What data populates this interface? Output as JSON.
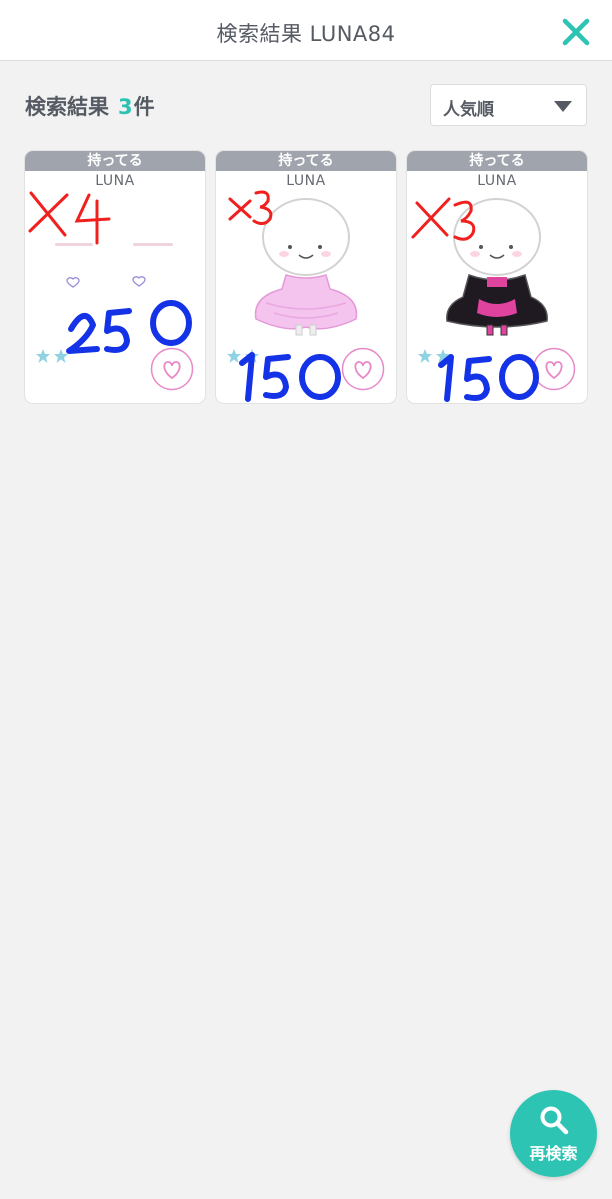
{
  "header": {
    "title": "検索結果 LUNA84",
    "close_icon": "close-icon",
    "close_color": "#2ec4b3"
  },
  "results": {
    "label": "検索結果",
    "count": "3",
    "unit": "件"
  },
  "sort": {
    "selected": "人気順",
    "icon": "caret-down-icon"
  },
  "cards": [
    {
      "owned_label": "持ってる",
      "brand": "LUNA",
      "item_type": "face-parts",
      "stars": 2,
      "favorited": false,
      "handwritten_qty": "X4",
      "handwritten_price": "250"
    },
    {
      "owned_label": "持ってる",
      "brand": "LUNA",
      "item_type": "pink-dress",
      "stars": 2,
      "favorited": false,
      "handwritten_qty": "x3",
      "handwritten_price": "150"
    },
    {
      "owned_label": "持ってる",
      "brand": "LUNA",
      "item_type": "black-pink-dress",
      "stars": 2,
      "favorited": false,
      "handwritten_qty": "X3",
      "handwritten_price": "150"
    }
  ],
  "fab": {
    "label": "再検索",
    "icon": "search-icon"
  },
  "colors": {
    "accent": "#2ec4b3",
    "owned_banner": "#a0a5ad",
    "heart": "#e889c8",
    "star": "#8fd3e3",
    "handwriting_red": "#f0201e",
    "handwriting_blue": "#1433e6"
  }
}
